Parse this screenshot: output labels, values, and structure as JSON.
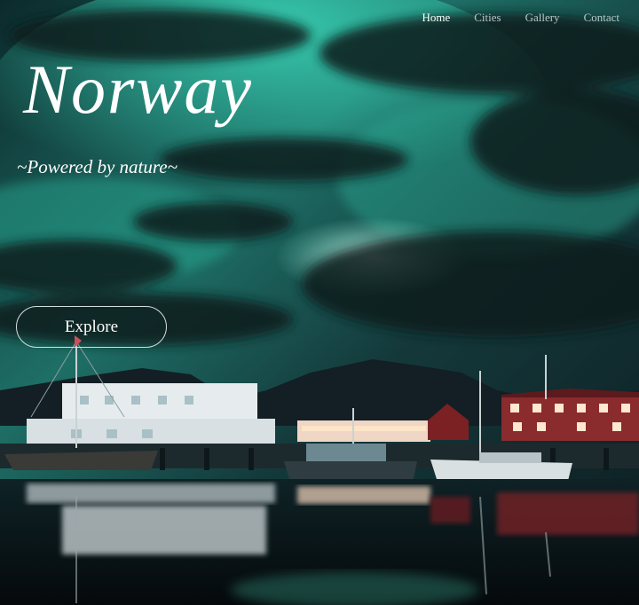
{
  "nav": {
    "items": [
      {
        "label": "Home",
        "active": true
      },
      {
        "label": "Cities",
        "active": false
      },
      {
        "label": "Gallery",
        "active": false
      },
      {
        "label": "Contact",
        "active": false
      }
    ]
  },
  "hero": {
    "title": "Norway",
    "subtitle": "~Powered by nature~",
    "cta_label": "Explore"
  },
  "colors": {
    "sky_teal": "#2fb8a0",
    "night_dark": "#0b1618",
    "red_houses": "#8a2b2e",
    "text": "#ffffff"
  }
}
